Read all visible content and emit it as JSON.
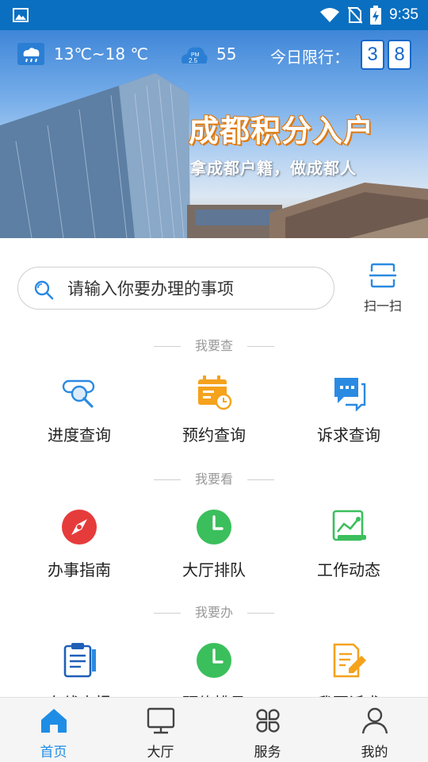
{
  "status_bar": {
    "time": "9:35",
    "icons": [
      "gallery-icon",
      "wifi-icon",
      "no-sim-icon",
      "battery-charging-icon"
    ]
  },
  "banner": {
    "temperature": "13℃~18 ℃",
    "aqi": "55",
    "pm_label_top": "PM",
    "pm_label_bottom": "2.5",
    "limit_label": "今日限行：",
    "limit_digits": [
      "3",
      "8"
    ],
    "title": "成都积分入户",
    "subtitle": "拿成都户籍，做成都人",
    "icons": [
      "weather-rain-icon",
      "pm25-cloud-icon"
    ]
  },
  "search": {
    "placeholder": "请输入你要办理的事项",
    "scan_label": "扫一扫"
  },
  "sections": [
    {
      "title": "我要查",
      "items": [
        {
          "label": "进度查询",
          "icon": "progress-search-icon"
        },
        {
          "label": "预约查询",
          "icon": "appointment-calendar-icon"
        },
        {
          "label": "诉求查询",
          "icon": "chat-bubble-icon"
        }
      ]
    },
    {
      "title": "我要看",
      "items": [
        {
          "label": "办事指南",
          "icon": "compass-icon"
        },
        {
          "label": "大厅排队",
          "icon": "clock-icon"
        },
        {
          "label": "工作动态",
          "icon": "trend-chart-icon"
        }
      ]
    },
    {
      "title": "我要办",
      "items": [
        {
          "label": "在线申报",
          "icon": "clipboard-icon"
        },
        {
          "label": "预约排号",
          "icon": "clock-icon"
        },
        {
          "label": "我要诉求",
          "icon": "edit-document-icon"
        }
      ]
    }
  ],
  "bottom_nav": [
    {
      "label": "首页",
      "icon": "home-icon",
      "active": true
    },
    {
      "label": "大厅",
      "icon": "monitor-icon",
      "active": false
    },
    {
      "label": "服务",
      "icon": "services-grid-icon",
      "active": false
    },
    {
      "label": "我的",
      "icon": "user-icon",
      "active": false
    }
  ],
  "colors": {
    "status_bar": "#0a6fc0",
    "accent_blue": "#1f8de6",
    "orange": "#f5a21c",
    "red": "#e63b3b",
    "green": "#3bbf5c"
  }
}
